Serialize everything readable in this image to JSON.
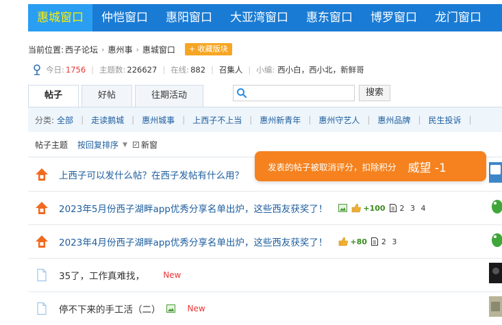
{
  "nav": {
    "items": [
      "惠城窗口",
      "仲恺窗口",
      "惠阳窗口",
      "大亚湾窗口",
      "惠东窗口",
      "博罗窗口",
      "龙门窗口"
    ],
    "active_index": 0
  },
  "breadcrumb": {
    "prefix": "当前位置:",
    "items": [
      "西子论坛",
      "惠州事",
      "惠城窗口"
    ],
    "separator": "›",
    "fav_button": "+ 收藏版块"
  },
  "stats": {
    "today_label": "今日:",
    "today_value": "1756",
    "topics_label": "主题数:",
    "topics_value": "226627",
    "online_label": "在线:",
    "online_value": "882",
    "gather": "召集人",
    "editors_label": "小编:",
    "editors_value": "西小白，西小北，新鲜哥"
  },
  "tabs": [
    "帖子",
    "好帖",
    "往期活动"
  ],
  "search": {
    "placeholder": "",
    "button": "搜索"
  },
  "categories": {
    "label": "分类:",
    "items": [
      "全部",
      "走读鹅城",
      "惠州城事",
      "上西子不上当",
      "惠州新青年",
      "惠州守艺人",
      "惠州品牌",
      "民生投诉"
    ]
  },
  "filter": {
    "title": "帖子主题",
    "sort": "按回复排序",
    "new_window": "新窗"
  },
  "threads": [
    {
      "title": "上西子可以发什么帖？在西子发帖有什么用？"
    },
    {
      "title": "2023年5月份西子湖畔app优秀分享名单出炉，这些西友获奖了！",
      "score": "+100",
      "pages": [
        "2",
        "3",
        "4"
      ]
    },
    {
      "title": "2023年4月份西子湖畔app优秀分享名单出炉，这些西友获奖了！",
      "score": "+80",
      "pages": [
        "2",
        "3"
      ]
    },
    {
      "title": "35了，工作真难找，",
      "badge": "New"
    },
    {
      "title": "停不下来的手工活（二）",
      "badge": "New"
    }
  ],
  "toast": {
    "message": "发表的帖子被取消评分，扣除积分",
    "points": "威望 -1"
  },
  "colors": {
    "nav_bg": "#1a7bd4",
    "nav_active": "#2a9ef2",
    "link": "#1d5d9e",
    "toast": "#f5821f",
    "new": "#e33333"
  }
}
